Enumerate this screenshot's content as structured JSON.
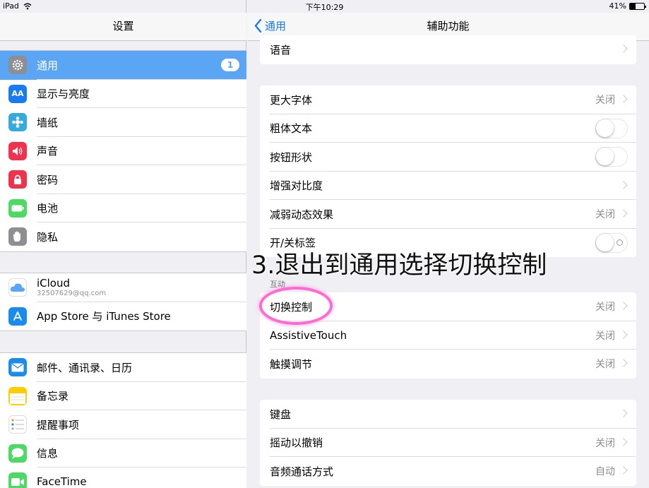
{
  "status": {
    "device": "iPad",
    "time": "下午10:29",
    "battery": "41%",
    "battery_level": 0.41
  },
  "left": {
    "title": "设置",
    "groups": [
      [
        {
          "label": "通用",
          "icon": "gear-icon",
          "color": "#8e8e93",
          "badge": "1",
          "selected": true
        },
        {
          "label": "显示与亮度",
          "icon": "aa-icon",
          "color": "#1a7bf0"
        },
        {
          "label": "墙纸",
          "icon": "flower-icon",
          "color": "#35aadc"
        },
        {
          "label": "声音",
          "icon": "speaker-icon",
          "color": "#f0324c"
        },
        {
          "label": "密码",
          "icon": "lock-icon",
          "color": "#f0324c"
        },
        {
          "label": "电池",
          "icon": "battery-icon",
          "color": "#4cd964"
        },
        {
          "label": "隐私",
          "icon": "hand-icon",
          "color": "#8e8e93"
        }
      ],
      [
        {
          "label": "iCloud",
          "sub": "32507629@qq.com",
          "icon": "cloud-icon",
          "color": "#ffffff"
        },
        {
          "label": "App Store 与 iTunes Store",
          "icon": "appstore-icon",
          "color": "#1a8cf0"
        }
      ],
      [
        {
          "label": "邮件、通讯录、日历",
          "icon": "mail-icon",
          "color": "#1a8cf0"
        },
        {
          "label": "备忘录",
          "icon": "notes-icon",
          "color": "#ffcc00"
        },
        {
          "label": "提醒事项",
          "icon": "reminders-icon",
          "color": "#ffffff"
        },
        {
          "label": "信息",
          "icon": "messages-icon",
          "color": "#4cd964"
        },
        {
          "label": "FaceTime",
          "icon": "facetime-icon",
          "color": "#4cd964"
        }
      ]
    ]
  },
  "right": {
    "back_label": "通用",
    "title": "辅助功能",
    "group0": [
      {
        "label": "语音",
        "chevron": true
      }
    ],
    "group1": [
      {
        "label": "更大字体",
        "value": "关闭",
        "chevron": true
      },
      {
        "label": "粗体文本",
        "toggle": true
      },
      {
        "label": "按钮形状",
        "toggle": true
      },
      {
        "label": "增强对比度",
        "chevron": true
      },
      {
        "label": "减弱动态效果",
        "value": "关闭",
        "chevron": true
      },
      {
        "label": "开/关标签",
        "toggle": true,
        "onoff": true
      }
    ],
    "section_interaction": "互动",
    "group2": [
      {
        "label": "切换控制",
        "value": "关闭",
        "chevron": true
      },
      {
        "label": "AssistiveTouch",
        "value": "关闭",
        "chevron": true
      },
      {
        "label": "触摸调节",
        "value": "关闭",
        "chevron": true
      }
    ],
    "group3": [
      {
        "label": "键盘",
        "chevron": true
      },
      {
        "label": "摇动以撤销",
        "value": "关闭",
        "chevron": true
      },
      {
        "label": "音频通话方式",
        "value": "自动",
        "chevron": true
      }
    ]
  },
  "annotation": "3.退出到通用选择切换控制"
}
